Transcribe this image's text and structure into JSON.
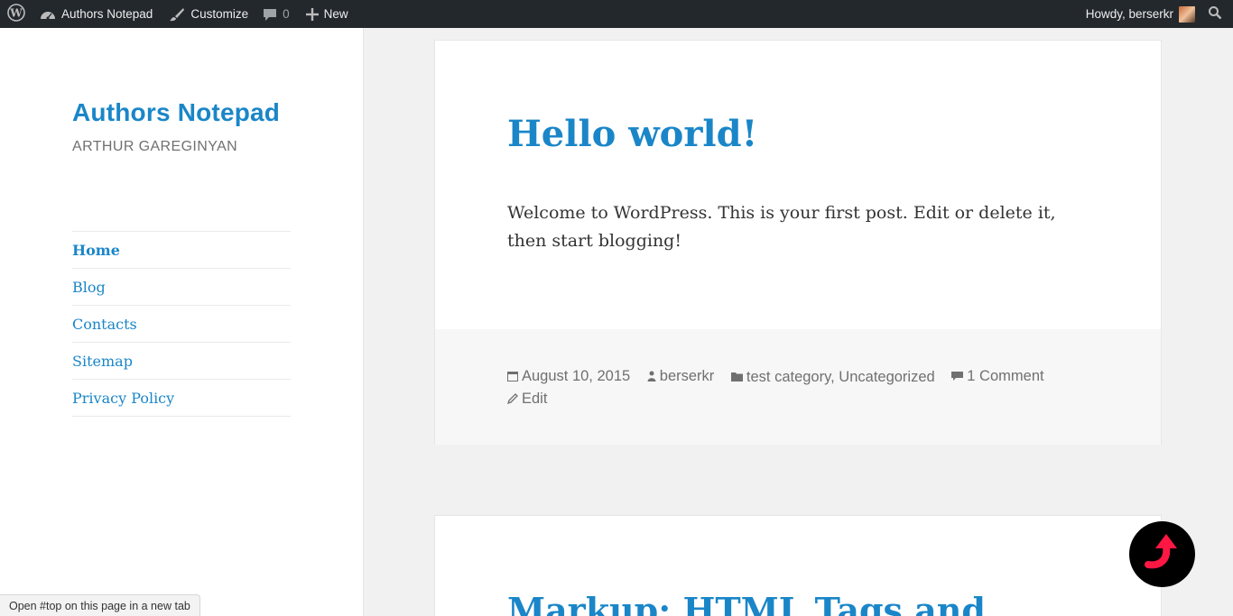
{
  "adminbar": {
    "site_name": "Authors Notepad",
    "customize": "Customize",
    "comments_count": "0",
    "new_label": "New",
    "howdy": "Howdy, berserkr",
    "icons": [
      "wordpress-icon",
      "dashboard-icon",
      "brush-icon",
      "comment-icon",
      "plus-icon",
      "search-icon"
    ]
  },
  "sidebar": {
    "site_title": "Authors Notepad",
    "site_description": "ARTHUR GAREGINYAN",
    "menu": [
      "Home",
      "Blog",
      "Contacts",
      "Sitemap",
      "Privacy Policy"
    ]
  },
  "post1": {
    "title": "Hello world!",
    "content": "Welcome to WordPress. This is your first post. Edit or delete it, then start blogging!",
    "meta": {
      "date": "August 10, 2015",
      "author": "berserkr",
      "categories": "test category, Uncategorized",
      "comments": "1 Comment",
      "edit": "Edit"
    }
  },
  "post2": {
    "title": "Markup: HTML Tags and"
  },
  "status_bar": "Open #top on this page in a new tab",
  "colors": {
    "accent": "#1a86c8",
    "adminbar": "#23282d",
    "totop_arrow": "#ff1744"
  }
}
